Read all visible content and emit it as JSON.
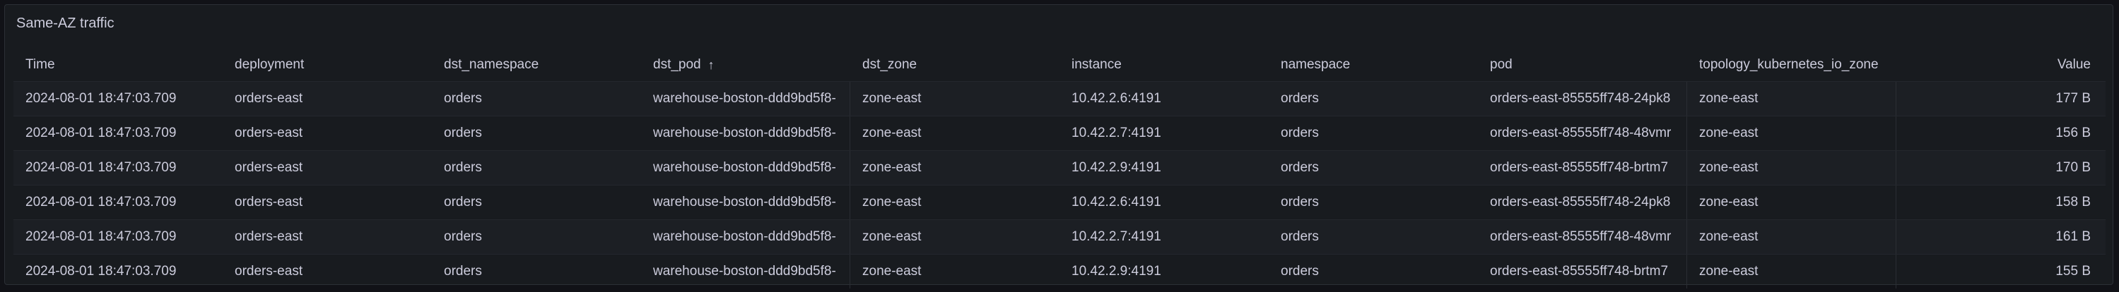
{
  "panel": {
    "title": "Same-AZ traffic"
  },
  "table": {
    "columns": [
      "Time",
      "deployment",
      "dst_namespace",
      "dst_pod",
      "dst_zone",
      "instance",
      "namespace",
      "pod",
      "topology_kubernetes_io_zone",
      "Value"
    ],
    "sort_icon": "↑",
    "rows": [
      [
        "2024-08-01 18:47:03.709",
        "orders-east",
        "orders",
        "warehouse-boston-ddd9bd5f8-",
        "zone-east",
        "10.42.2.6:4191",
        "orders",
        "orders-east-85555ff748-24pk8",
        "zone-east",
        "177 B"
      ],
      [
        "2024-08-01 18:47:03.709",
        "orders-east",
        "orders",
        "warehouse-boston-ddd9bd5f8-",
        "zone-east",
        "10.42.2.7:4191",
        "orders",
        "orders-east-85555ff748-48vmr",
        "zone-east",
        "156 B"
      ],
      [
        "2024-08-01 18:47:03.709",
        "orders-east",
        "orders",
        "warehouse-boston-ddd9bd5f8-",
        "zone-east",
        "10.42.2.9:4191",
        "orders",
        "orders-east-85555ff748-brtm7",
        "zone-east",
        "170 B"
      ],
      [
        "2024-08-01 18:47:03.709",
        "orders-east",
        "orders",
        "warehouse-boston-ddd9bd5f8-",
        "zone-east",
        "10.42.2.6:4191",
        "orders",
        "orders-east-85555ff748-24pk8",
        "zone-east",
        "158 B"
      ],
      [
        "2024-08-01 18:47:03.709",
        "orders-east",
        "orders",
        "warehouse-boston-ddd9bd5f8-",
        "zone-east",
        "10.42.2.7:4191",
        "orders",
        "orders-east-85555ff748-48vmr",
        "zone-east",
        "161 B"
      ],
      [
        "2024-08-01 18:47:03.709",
        "orders-east",
        "orders",
        "warehouse-boston-ddd9bd5f8-",
        "zone-east",
        "10.42.2.9:4191",
        "orders",
        "orders-east-85555ff748-brtm7",
        "zone-east",
        "155 B"
      ]
    ]
  }
}
